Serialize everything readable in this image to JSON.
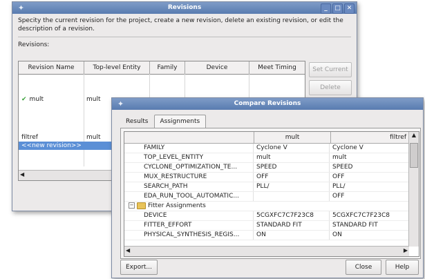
{
  "revisions_window": {
    "title": "Revisions",
    "description": "Specity the current revision for the project, create a new revision, delete an existing revision, or edit the description of a revision.",
    "list_label": "Revisions:",
    "columns": [
      "Revision Name",
      "Top-level Entity",
      "Family",
      "Device",
      "Meet Timing"
    ],
    "rows": [
      {
        "name": "mult",
        "entity": "mult",
        "current": true
      },
      {
        "name": "filtref",
        "entity": "mult",
        "current": false
      }
    ],
    "new_revision_label": "<<new revision>>",
    "buttons": {
      "set_current": "Set Current",
      "delete": "Delete"
    }
  },
  "compare_window": {
    "title": "Compare Revisions",
    "tabs": [
      "Results",
      "Assignments"
    ],
    "active_tab": "Assignments",
    "columns": [
      "",
      "mult",
      "filtref"
    ],
    "rows": [
      {
        "name": "FAMILY",
        "mult": "Cyclone V",
        "filtref": "Cyclone V"
      },
      {
        "name": "TOP_LEVEL_ENTITY",
        "mult": "mult",
        "filtref": "mult"
      },
      {
        "name": "CYCLONE_OPTIMIZATION_TE...",
        "mult": "SPEED",
        "filtref": "SPEED"
      },
      {
        "name": "MUX_RESTRUCTURE",
        "mult": "OFF",
        "filtref": "OFF"
      },
      {
        "name": "SEARCH_PATH",
        "mult": "PLL/",
        "filtref": "PLL/"
      },
      {
        "name": "EDA_RUN_TOOL_AUTOMATIC...",
        "mult": "",
        "filtref": "OFF"
      },
      {
        "name": "Fitter Assignments",
        "group": true,
        "expander": "−"
      },
      {
        "name": "DEVICE",
        "mult": "5CGXFC7C7F23C8",
        "filtref": "5CGXFC7C7F23C8"
      },
      {
        "name": "FITTER_EFFORT",
        "mult": "STANDARD FIT",
        "filtref": "STANDARD FIT"
      },
      {
        "name": "PHYSICAL_SYNTHESIS_REGIS...",
        "mult": "ON",
        "filtref": "ON"
      }
    ],
    "buttons": {
      "export": "Export...",
      "close": "Close",
      "help": "Help"
    }
  },
  "colors": {
    "titlebar": "#6a8ac0",
    "selection": "#5b8fd6",
    "check": "#3aa13a"
  }
}
